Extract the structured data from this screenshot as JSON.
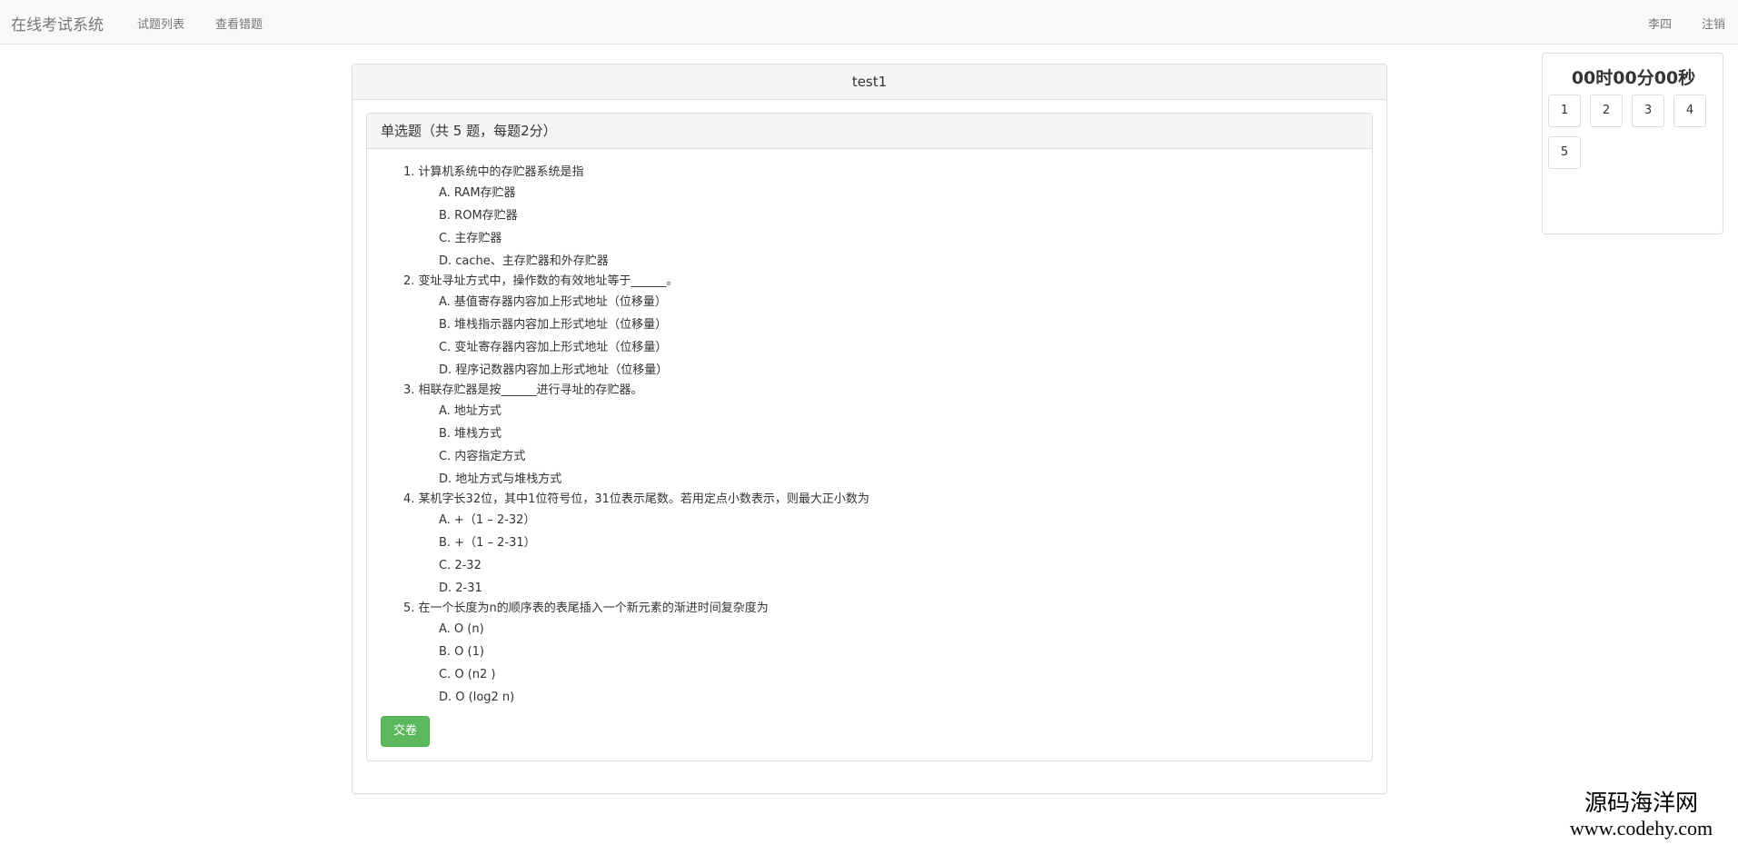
{
  "navbar": {
    "brand": "在线考试系统",
    "links": [
      "试题列表",
      "查看错题"
    ],
    "user": "李四",
    "logout": "注销"
  },
  "exam": {
    "title": "test1",
    "section_title": "单选题（共 5 题，每题2分）",
    "questions": [
      {
        "num": "1.",
        "stem": "计算机系统中的存贮器系统是指",
        "options": [
          "A. RAM存贮器",
          "B. ROM存贮器",
          "C. 主存贮器",
          "D. cache、主存贮器和外存贮器"
        ]
      },
      {
        "num": "2.",
        "stem": "变址寻址方式中，操作数的有效地址等于______。",
        "options": [
          "A. 基值寄存器内容加上形式地址（位移量）",
          "B. 堆栈指示器内容加上形式地址（位移量）",
          "C. 变址寄存器内容加上形式地址（位移量）",
          "D. 程序记数器内容加上形式地址（位移量）"
        ]
      },
      {
        "num": "3.",
        "stem": "相联存贮器是按______进行寻址的存贮器。",
        "options": [
          "A. 地址方式",
          "B. 堆栈方式",
          "C. 内容指定方式",
          "D. 地址方式与堆栈方式"
        ]
      },
      {
        "num": "4.",
        "stem": "某机字长32位，其中1位符号位，31位表示尾数。若用定点小数表示，则最大正小数为",
        "options": [
          "A. +（1 – 2-32）",
          "B. +（1 – 2-31）",
          "C. 2-32",
          "D. 2-31"
        ]
      },
      {
        "num": "5.",
        "stem": "在一个长度为n的顺序表的表尾插入一个新元素的渐进时间复杂度为",
        "options": [
          "A. O (n)",
          "B. O (1)",
          "C. O (n2 )",
          "D. O (log2 n)"
        ]
      }
    ],
    "submit_label": "交卷"
  },
  "sidebar": {
    "timer": "00时00分00秒",
    "question_nav": [
      "1",
      "2",
      "3",
      "4",
      "5"
    ]
  },
  "watermark": {
    "line1": "源码海洋网",
    "line2": "www.codehy.com"
  }
}
